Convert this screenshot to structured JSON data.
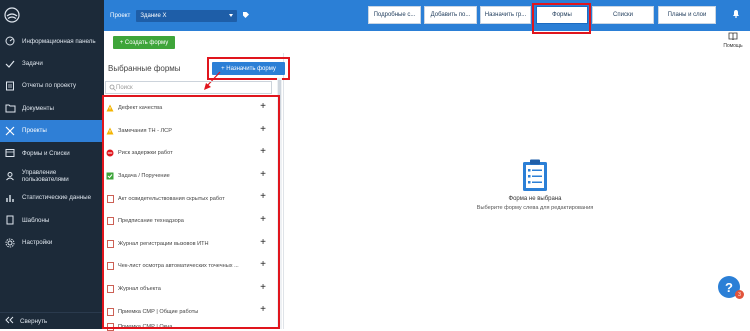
{
  "sidebar": {
    "items": [
      {
        "label": "Информационная панель",
        "icon": "dashboard-icon"
      },
      {
        "label": "Задачи",
        "icon": "tasks-icon"
      },
      {
        "label": "Отчеты по проекту",
        "icon": "reports-icon"
      },
      {
        "label": "Документы",
        "icon": "folder-icon"
      },
      {
        "label": "Проекты",
        "icon": "tools-icon",
        "active": true
      },
      {
        "label": "Формы и Списки",
        "icon": "forms-icon"
      },
      {
        "label": "Управление пользователями",
        "icon": "users-icon"
      },
      {
        "label": "Статистические данные",
        "icon": "stats-icon"
      },
      {
        "label": "Шаблоны",
        "icon": "templates-icon"
      },
      {
        "label": "Настройки",
        "icon": "settings-icon"
      }
    ],
    "collapse_label": "Свернуть"
  },
  "topbar": {
    "project_label": "Проект",
    "project_value": "Здание X",
    "tabs": [
      {
        "label": "Подробные с..."
      },
      {
        "label": "Добавить по..."
      },
      {
        "label": "Назначить гр..."
      },
      {
        "label": "Формы",
        "selected": true
      },
      {
        "label": "Списки"
      },
      {
        "label": "Планы и слои"
      }
    ]
  },
  "toolbar": {
    "create_form_label": "+ Создать форму",
    "help_doc_label": "Помощь"
  },
  "panel": {
    "title": "Выбранные формы",
    "assign_label": "+ Назначить форму",
    "search_placeholder": "Поиск",
    "items": [
      {
        "label": "Дефект качества",
        "icon": "warning-icon"
      },
      {
        "label": "Замечания ТН - ЛСР",
        "icon": "warning-icon"
      },
      {
        "label": "Риск задержки работ",
        "icon": "stop-icon"
      },
      {
        "label": "Задача / Поручение",
        "icon": "checkbox-icon"
      },
      {
        "label": "Акт освидетельствования скрытых работ",
        "icon": "document-icon"
      },
      {
        "label": "Предписание технадзора",
        "icon": "document-icon"
      },
      {
        "label": "Журнал регистрации вызовов ИТН",
        "icon": "document-icon"
      },
      {
        "label": "Чек-лист осмотра автоматических точечных ...",
        "icon": "document-icon"
      },
      {
        "label": "Журнал объекта",
        "icon": "document-icon"
      },
      {
        "label": "Приемка СМР | Общие работы",
        "icon": "document-icon"
      },
      {
        "label": "Приемка СМР | Окна",
        "icon": "document-icon"
      }
    ]
  },
  "empty_state": {
    "title": "Форма не выбрана",
    "subtitle": "Выберите форму слева для редактирования"
  },
  "help": {
    "label": "?",
    "badge": "3"
  },
  "colors": {
    "accent": "#2b7fd6",
    "sidebar": "#1c2a39",
    "create": "#3ea53a",
    "highlight": "#e0151d"
  }
}
